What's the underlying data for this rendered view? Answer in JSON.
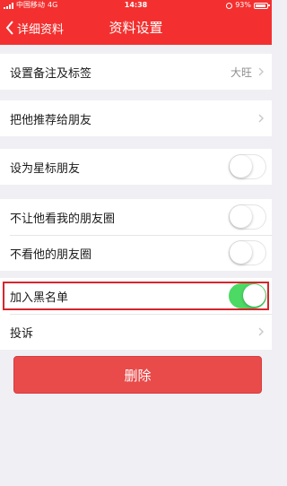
{
  "status_bar": {
    "carrier": "中国移动",
    "network": "4G",
    "time": "14:38",
    "battery": "93%"
  },
  "nav": {
    "back_label": "详细资料",
    "title": "资料设置"
  },
  "groups": {
    "remark": {
      "label": "设置备注及标签",
      "value": "大旺"
    },
    "recommend": {
      "label": "把他推荐给朋友"
    },
    "star": {
      "label": "设为星标朋友",
      "enabled": false
    },
    "moments_block": {
      "label": "不让他看我的朋友圈",
      "enabled": false
    },
    "moments_hide": {
      "label": "不看他的朋友圈",
      "enabled": false
    },
    "blacklist": {
      "label": "加入黑名单",
      "enabled": true
    },
    "complain": {
      "label": "投诉"
    }
  },
  "delete_button": {
    "label": "删除"
  },
  "colors": {
    "brand_red": "#f3302f",
    "switch_on": "#4cd964",
    "delete_red": "#e94b4b",
    "highlight_border": "#d6252d"
  }
}
